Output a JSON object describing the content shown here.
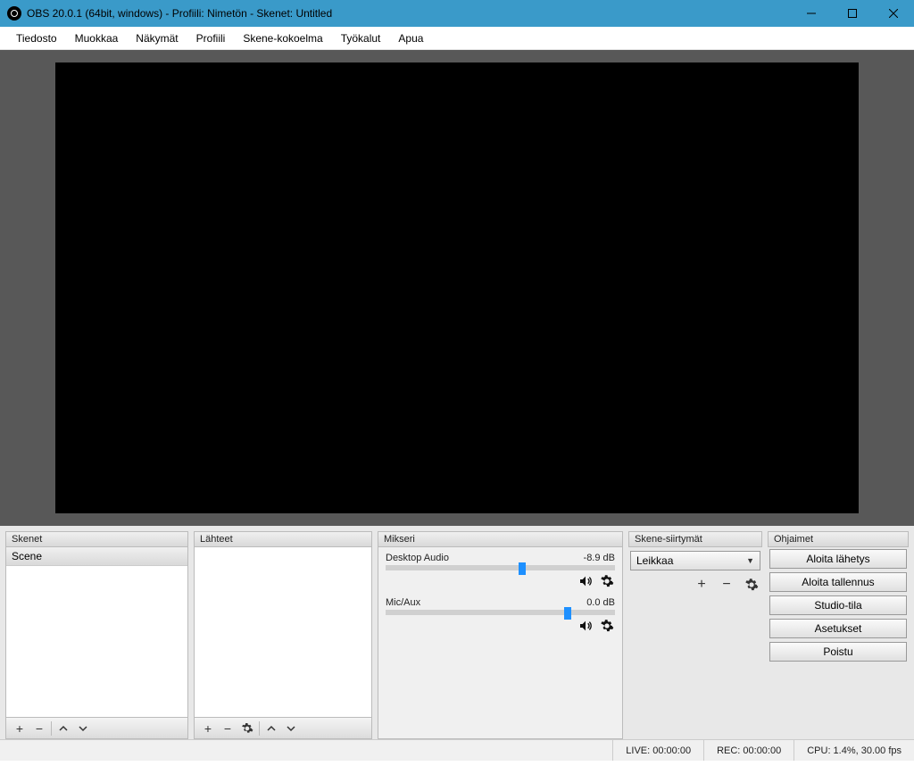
{
  "titlebar": {
    "title": "OBS 20.0.1 (64bit, windows) - Profiili: Nimetön - Skenet: Untitled"
  },
  "menu": {
    "file": "Tiedosto",
    "edit": "Muokkaa",
    "view": "Näkymät",
    "profile": "Profiili",
    "scenecol": "Skene-kokoelma",
    "tools": "Työkalut",
    "help": "Apua"
  },
  "panels": {
    "scenes": {
      "title": "Skenet",
      "item0": "Scene"
    },
    "sources": {
      "title": "Lähteet"
    },
    "mixer": {
      "title": "Mikseri",
      "ch0": {
        "name": "Desktop Audio",
        "db": "-8.9 dB"
      },
      "ch1": {
        "name": "Mic/Aux",
        "db": "0.0 dB"
      }
    },
    "transitions": {
      "title": "Skene-siirtymät",
      "selected": "Leikkaa"
    },
    "controls": {
      "title": "Ohjaimet",
      "btn0": "Aloita lähetys",
      "btn1": "Aloita tallennus",
      "btn2": "Studio-tila",
      "btn3": "Asetukset",
      "btn4": "Poistu"
    }
  },
  "status": {
    "live": "LIVE: 00:00:00",
    "rec": "REC: 00:00:00",
    "cpu": "CPU: 1.4%, 30.00 fps"
  }
}
